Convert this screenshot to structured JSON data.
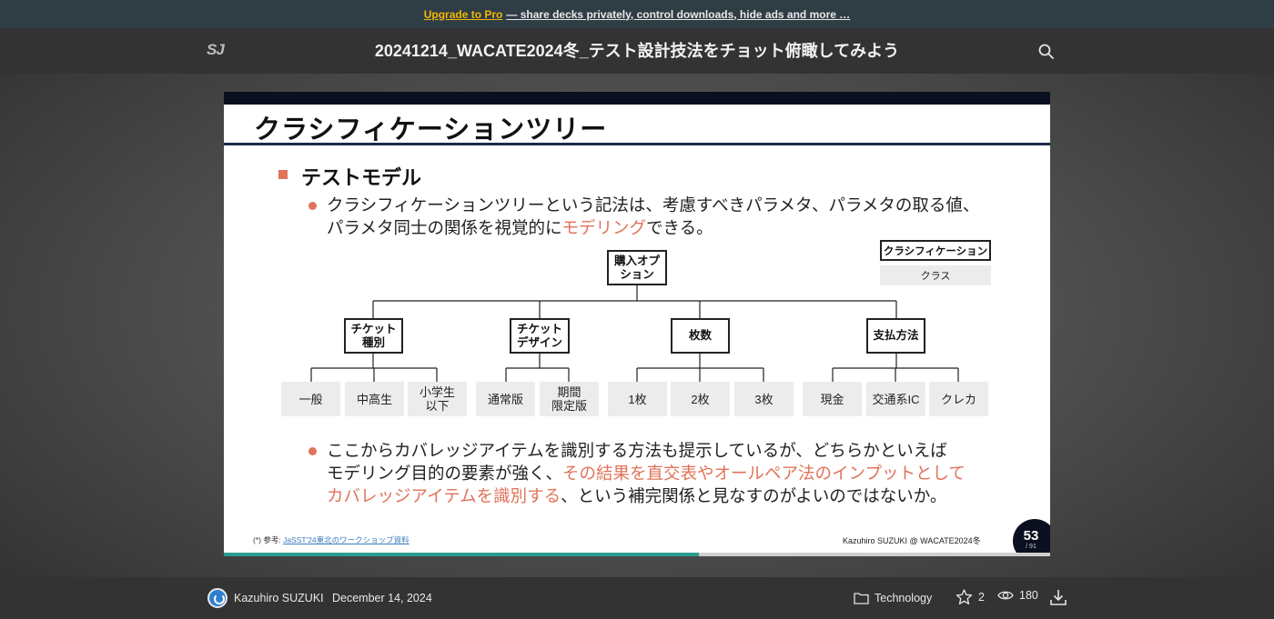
{
  "promo": {
    "link": "Upgrade to Pro",
    "text": "— share decks privately, control downloads, hide ads and more …"
  },
  "header": {
    "logo": "SJ",
    "title": "20241214_WACATE2024冬_テスト設計技法をチョット俯瞰してみよう"
  },
  "slide": {
    "heading": "クラシフィケーションツリー",
    "section": "テストモデル",
    "para1_line1": "クラシフィケーションツリーという記法は、考慮すべきパラメタ、パラメタの取る値、",
    "para1_line2_pre": "パラメタ同士の関係を視覚的に",
    "para1_line2_hl": "モデリング",
    "para1_line2_post": "できる。",
    "legend_class": "クラシフィケーション",
    "legend_sub": "クラス",
    "root": [
      "購入オプ",
      "ション"
    ],
    "classifications": [
      {
        "lines": [
          "チケット",
          "種別"
        ],
        "classes": [
          [
            "一般"
          ],
          [
            "中高生"
          ],
          [
            "小学生",
            "以下"
          ]
        ]
      },
      {
        "lines": [
          "チケット",
          "デザイン"
        ],
        "classes": [
          [
            "通常版"
          ],
          [
            "期間",
            "限定版"
          ]
        ]
      },
      {
        "lines": [
          "枚数"
        ],
        "classes": [
          [
            "1枚"
          ],
          [
            "2枚"
          ],
          [
            "3枚"
          ]
        ]
      },
      {
        "lines": [
          "支払方法"
        ],
        "classes": [
          [
            "現金"
          ],
          [
            "交通系IC"
          ],
          [
            "クレカ"
          ]
        ]
      }
    ],
    "para2_line1": "ここからカバレッジアイテムを識別する方法も提示しているが、どちらかといえば",
    "para2_line2_pre": "モデリング目的の要素が強く、",
    "para2_line2_hl": "その結果を直交表やオールペア法のインプットとして",
    "para2_line3_hl": "カバレッジアイテムを識別する",
    "para2_line3_post": "、という補完関係と見なすのがよいのではないか。",
    "footnote_prefix": "(*) 参考:",
    "footnote_link": "JaSST'24東北のワークショップ資料",
    "credit": "Kazuhiro SUZUKI @ WACATE2024冬",
    "page": "53",
    "total": "/ 91"
  },
  "progress": 0.575,
  "footer": {
    "author": "Kazuhiro SUZUKI",
    "date": "December 14, 2024",
    "category": "Technology",
    "stars": "2",
    "views": "180"
  },
  "colors": {
    "accent": "#e0735a",
    "slide_band": "#0b1020",
    "progress": "#2a9d8f",
    "promo_link": "#f2b705"
  },
  "icons": [
    "search-icon",
    "folder-icon",
    "star-icon",
    "eye-icon",
    "download-icon"
  ]
}
